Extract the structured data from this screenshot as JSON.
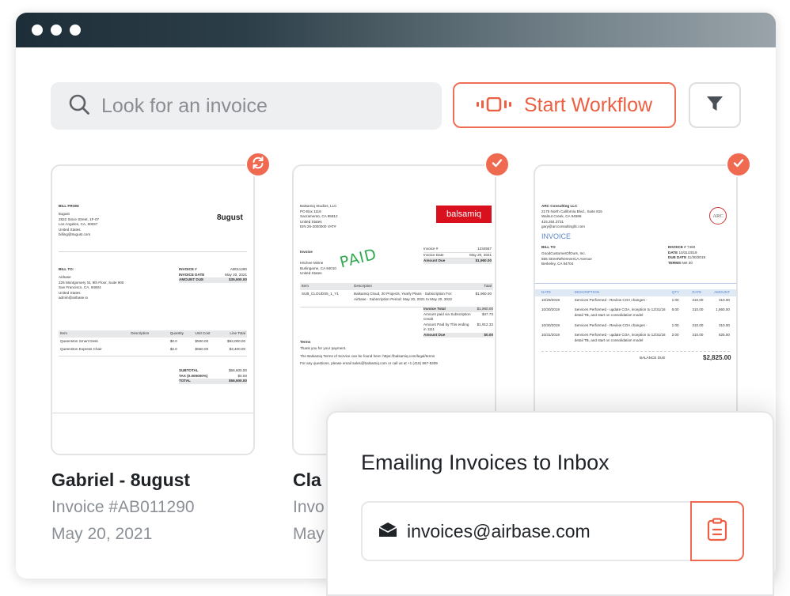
{
  "window": {
    "dots": 3
  },
  "search": {
    "placeholder": "Look for an invoice"
  },
  "toolbar": {
    "workflow_label": "Start Workflow"
  },
  "colors": {
    "accent": "#ec5f43",
    "titlebar_dark": "#1e2e38"
  },
  "cards": [
    {
      "title": "Gabriel - 8ugust",
      "invoice": "Invoice #AB011290",
      "date": "May 20, 2021",
      "status_icon": "refresh-icon",
      "doc": {
        "from_label": "BILL FROM:",
        "from_lines": [
          "8ugust",
          "2822 Since Street, 1F-07",
          "Los Angeles, CA, 90037",
          "United States",
          "billing@8ugust.com"
        ],
        "logo": "8ugust",
        "to_label": "BILL TO:",
        "to_lines": [
          "Airbase",
          "225 Montgomery St, 9th Floor, Suite 900",
          "San Francisco, CA, 94604",
          "United States",
          "admin@airbase.io"
        ],
        "meta": [
          [
            "INVOICE #",
            "AB011290"
          ],
          [
            "INVOICE DATE",
            "May 20, 2021"
          ],
          [
            "AMOUNT DUE",
            "$35,600.00"
          ]
        ],
        "columns": [
          "Item",
          "Description",
          "Quantity",
          "Unit Cost",
          "Line Total"
        ],
        "rows": [
          [
            "Queenston Smart Desk",
            "",
            "$0.0",
            "$500.00",
            "$53,000.00"
          ],
          [
            "Queenston Express Chair",
            "",
            "$2.0",
            "$550.00",
            "$3,400.00"
          ]
        ],
        "totals": [
          [
            "SUBTOTAL",
            "$56,600.00"
          ],
          [
            "TAX (0.000000%)",
            "$0.00"
          ],
          [
            "TOTAL",
            "$56,600.00"
          ]
        ]
      }
    },
    {
      "title": "Cla",
      "invoice": "Invo",
      "date": "May",
      "status_icon": "check-icon",
      "doc": {
        "from_lines": [
          "Balsamiq Studios, LLC",
          "PO Box 1118",
          "Sacramento, CA 95812",
          "United States",
          "EIN 26-2000000 VAT#"
        ],
        "logo": "balsamiq",
        "meta": [
          [
            "Invoice #",
            "1234567"
          ],
          [
            "Invoice Date",
            "May 20, 2021"
          ],
          [
            "Amount Due",
            "$1,960.00"
          ]
        ],
        "stamp": "PAID",
        "to_label": "Invoice",
        "to_lines": [
          "Hitchee Mirine",
          "Burlingame, CA 94010",
          "United States"
        ],
        "columns": [
          "Item",
          "Description",
          "Total"
        ],
        "rows": [
          [
            "SUB_CLOUDS5_1_Y1",
            "Balsamiq Cloud, 20 Projects, Yearly Plans · Subscription For: Airbase · Subscription Period: May 20, 2021 to May 20, 2022",
            "$1,960.00"
          ]
        ],
        "totals": [
          [
            "Invoice Total",
            "$1,960.00"
          ],
          [
            "Amount paid via Subscription Credit",
            "$47.73"
          ],
          [
            "Amount Paid by This ending in 1111",
            "$1,912.32"
          ],
          [
            "Amount Due",
            "$0.00"
          ]
        ],
        "terms_label": "Terms",
        "terms_lines": [
          "Thank you for your payment.",
          "The Balsamiq Terms of Service can be found here: https://balsamiq.com/legal/terms",
          "For any questions, please email sales@balsamiq.com or call us at +1 (415) 867-5309"
        ]
      }
    },
    {
      "status_icon": "check-icon",
      "doc": {
        "from_lines": [
          "ARC Consulting LLC",
          "2175 North California Blvd., Suite 815",
          "Walnut Creek, CA 94596",
          "415.264.3731",
          "gary@arcconsultingllc.com"
        ],
        "logo": "ARC",
        "heading": "INVOICE",
        "bill_label": "BILL TO",
        "bill_lines": [
          "GoodCustomerOfOurs, Inc.",
          "556 StreetWhereverCA Avenue",
          "Berkeley, CA 94704"
        ],
        "meta": [
          [
            "INVOICE #",
            "7460"
          ],
          [
            "DATE",
            "10/31/2019"
          ],
          [
            "DUE DATE",
            "11/30/2019"
          ],
          [
            "TERMS",
            "Net 30"
          ]
        ],
        "columns": [
          "DATE",
          "DESCRIPTION",
          "QTY",
          "RATE",
          "AMOUNT"
        ],
        "rows": [
          [
            "10/29/2019",
            "Services Performed - Review COA changes -",
            "1:00",
            "310.00",
            "310.00"
          ],
          [
            "10/30/2019",
            "Services Performed - update COA, inception to 12/31/18 detail TB, and start on consolidation model",
            "6:00",
            "310.00",
            "1,860.00"
          ],
          [
            "10/30/2019",
            "Services Performed - Review COA changes -",
            "1:00",
            "310.00",
            "310.00"
          ],
          [
            "10/31/2019",
            "Services Performed - update COA, inception to 12/31/18 detail TB, and start on consolidation model",
            "2:00",
            "310.00",
            "625.00"
          ]
        ],
        "balance_label": "BALANCE DUE",
        "balance_value": "$2,825.00"
      }
    }
  ],
  "email_panel": {
    "heading": "Emailing Invoices to Inbox",
    "email": "invoices@airbase.com"
  }
}
